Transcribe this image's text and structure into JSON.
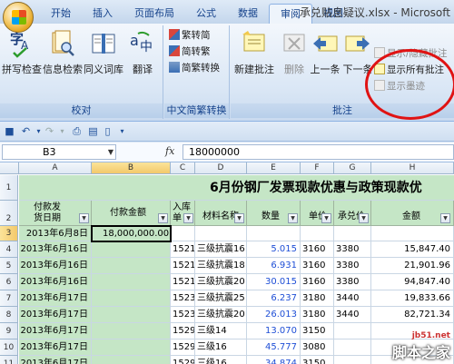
{
  "window": {
    "title": "承兑贴息疑议.xlsx - Microsoft"
  },
  "tabs": [
    "开始",
    "插入",
    "页面布局",
    "公式",
    "数据",
    "审阅",
    "视图"
  ],
  "active_tab": "审阅",
  "ribbon": {
    "proofing": {
      "label": "校对",
      "spell": "拼写检查",
      "research": "信息检索",
      "thesaurus": "同义词库",
      "translate": "翻译"
    },
    "chinese": {
      "label": "中文简繁转换",
      "to_simplified": "繁转简",
      "to_traditional": "简转繁",
      "convert": "简繁转换"
    },
    "comments": {
      "label": "批注",
      "new": "新建批注",
      "delete": "删除",
      "prev": "上一条",
      "next": "下一条",
      "show_hide": "显示/隐藏批注",
      "show_all": "显示所有批注",
      "show_ink": "显示墨迹"
    }
  },
  "formula_bar": {
    "cell_ref": "B3",
    "fx": "fx",
    "value": "18000000"
  },
  "columns": [
    "A",
    "B",
    "C",
    "D",
    "E",
    "F",
    "G",
    "H"
  ],
  "rows": [
    "1",
    "2",
    "3",
    "4",
    "5",
    "6",
    "7",
    "8",
    "9",
    "10",
    "11"
  ],
  "sheet_title": "6月份钢厂发票现款优惠与政策现款优",
  "headers": {
    "a": "付款发\n货日期",
    "b": "付款金额",
    "c": "入库\n单",
    "d": "材料名称",
    "e": "数量",
    "f": "单价",
    "g": "承兑价",
    "h": "金额"
  },
  "data_rows": [
    {
      "a": "2013年6月8日",
      "b": "18,000,000.00",
      "c": "",
      "d": "",
      "e": "",
      "f": "",
      "g": "",
      "h": ""
    },
    {
      "a": "2013年6月16日",
      "b": "",
      "c": "1521",
      "d": "三级抗震16",
      "e": "5.015",
      "f": "3160",
      "g": "3380",
      "h": "15,847.40"
    },
    {
      "a": "2013年6月16日",
      "b": "",
      "c": "1521",
      "d": "三级抗震18",
      "e": "6.931",
      "f": "3160",
      "g": "3380",
      "h": "21,901.96"
    },
    {
      "a": "2013年6月16日",
      "b": "",
      "c": "1521",
      "d": "三级抗震20",
      "e": "30.015",
      "f": "3160",
      "g": "3380",
      "h": "94,847.40"
    },
    {
      "a": "2013年6月17日",
      "b": "",
      "c": "1523",
      "d": "三级抗震25",
      "e": "6.237",
      "f": "3180",
      "g": "3440",
      "h": "19,833.66"
    },
    {
      "a": "2013年6月17日",
      "b": "",
      "c": "1523",
      "d": "三级抗震20",
      "e": "26.013",
      "f": "3180",
      "g": "3440",
      "h": "82,721.34"
    },
    {
      "a": "2013年6月17日",
      "b": "",
      "c": "1529",
      "d": "三级14",
      "e": "13.070",
      "f": "3150",
      "g": "",
      "h": ""
    },
    {
      "a": "2013年6月17日",
      "b": "",
      "c": "1529",
      "d": "三级16",
      "e": "45.777",
      "f": "3080",
      "g": "",
      "h": ""
    },
    {
      "a": "2013年6月17日",
      "b": "",
      "c": "1529",
      "d": "三级16",
      "e": "34.874",
      "f": "3150",
      "g": "",
      "h": ""
    }
  ],
  "watermark": {
    "url": "jb51.net",
    "name": "脚本之家"
  }
}
